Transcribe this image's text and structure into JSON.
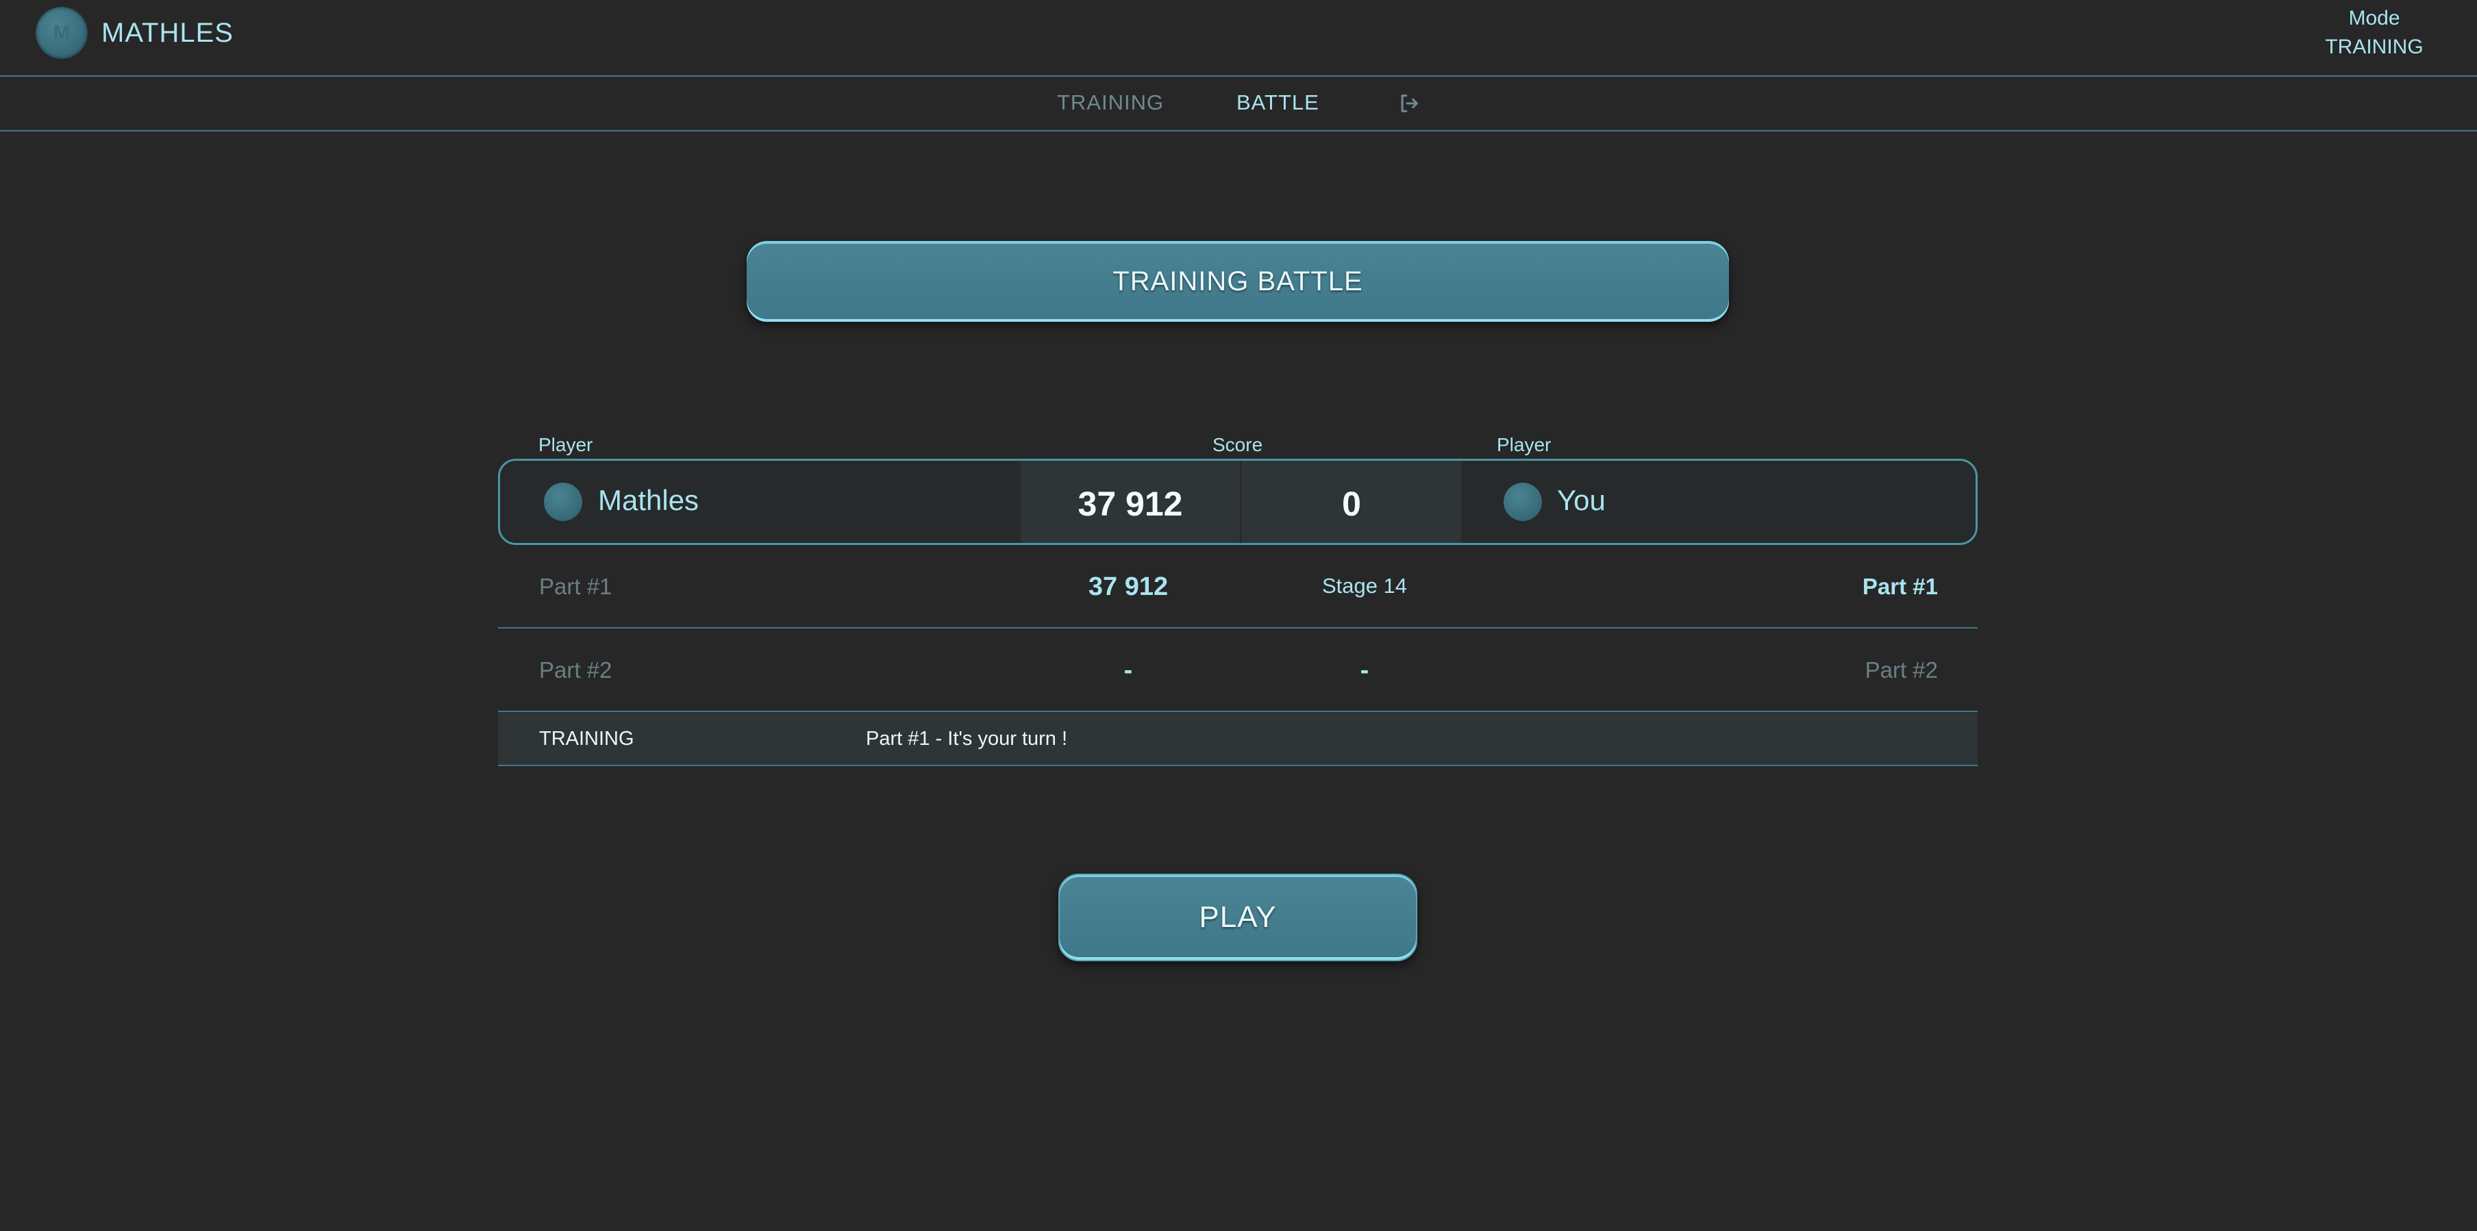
{
  "header": {
    "app_title": "MATHLES",
    "logo_letter": "M",
    "mode_label": "Mode",
    "mode_value": "TRAINING"
  },
  "nav": {
    "training": "TRAINING",
    "battle": "BATTLE",
    "logout_icon": "sign-out-icon"
  },
  "hero": {
    "label": "TRAINING BATTLE"
  },
  "scoreboard": {
    "headers": {
      "player_left": "Player",
      "score": "Score",
      "player_right": "Player"
    },
    "left_player": {
      "name": "Mathles",
      "score": "37 912"
    },
    "right_player": {
      "name": "You",
      "score": "0"
    }
  },
  "parts": [
    {
      "left": "Part #1",
      "score": "37 912",
      "stage": "Stage 14",
      "right": "Part #1"
    },
    {
      "left": "Part #2",
      "score": "-",
      "stage": "-",
      "right": "Part #2"
    }
  ],
  "status": {
    "mode": "TRAINING",
    "message": "Part #1 - It's your turn !"
  },
  "play": {
    "label": "PLAY"
  },
  "colors": {
    "background": "#272727",
    "accent": "#a9e4f0",
    "button": "#427b8b",
    "muted": "#6b7f85"
  }
}
